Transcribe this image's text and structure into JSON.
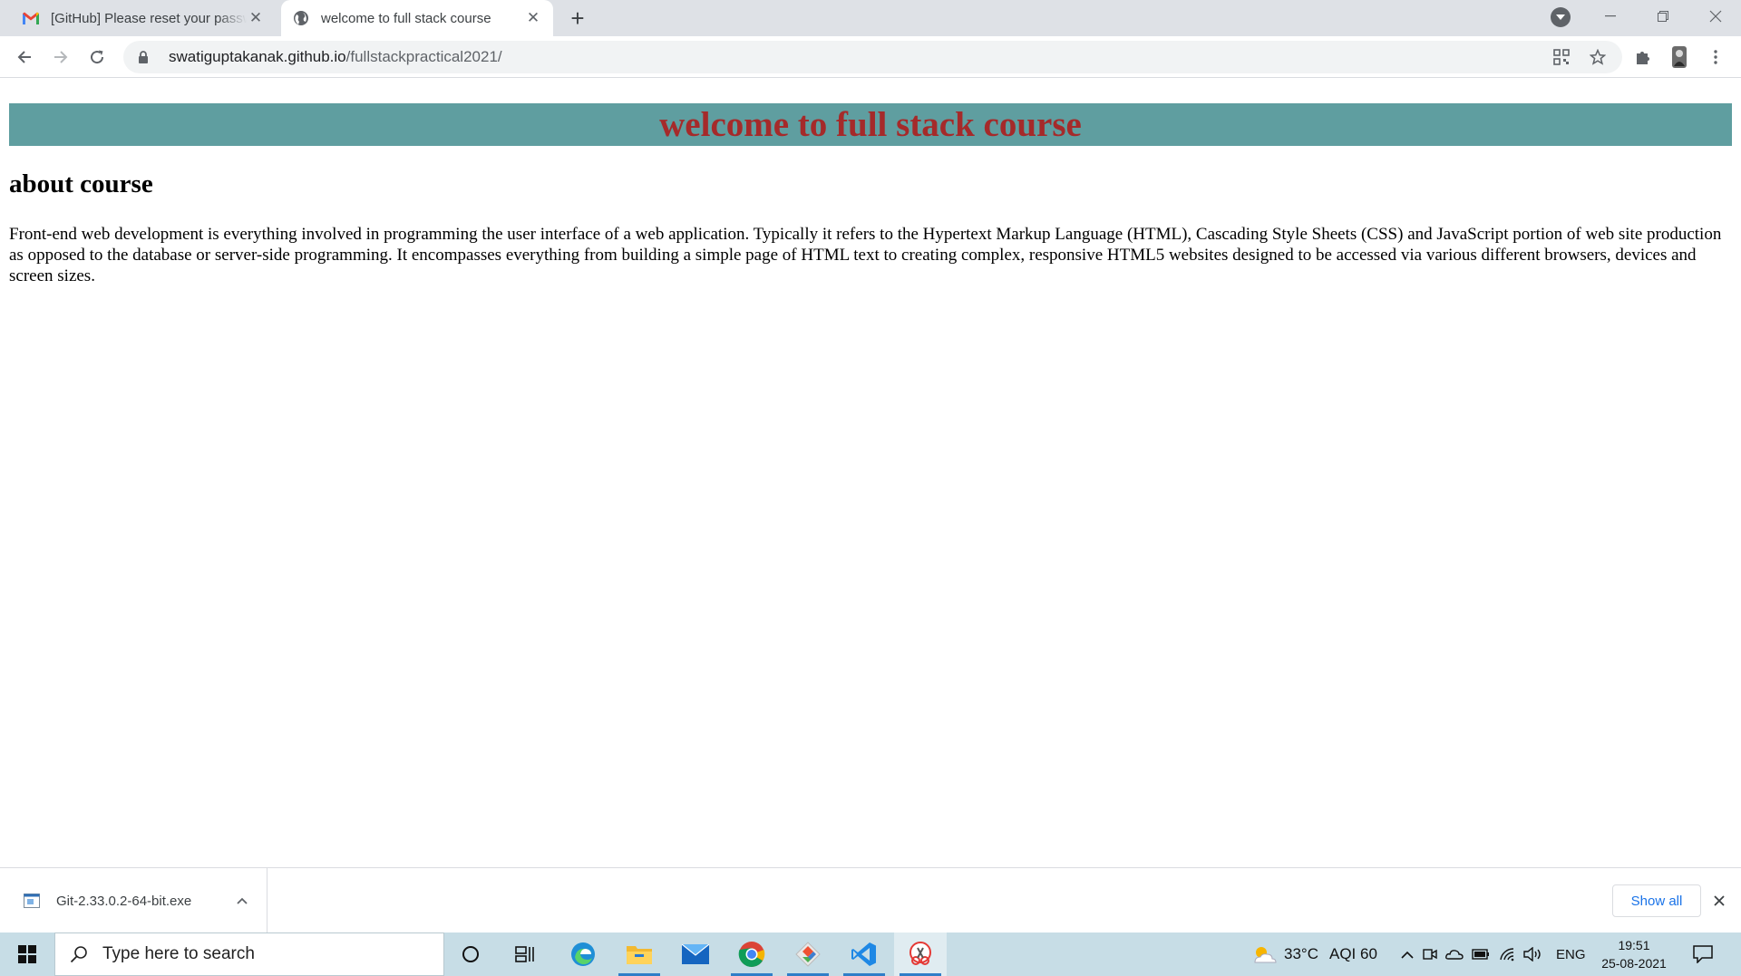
{
  "browser": {
    "tabs": [
      {
        "title": "[GitHub] Please reset your password",
        "favicon": "gmail-icon"
      },
      {
        "title": "welcome to full stack course",
        "favicon": "globe-icon"
      }
    ],
    "new_tab": "+",
    "url_host": "swatiguptakanak.github.io",
    "url_path": "/fullstackpractical2021/"
  },
  "page": {
    "banner_title": "welcome to full stack course",
    "section_heading": "about course",
    "paragraph": "Front-end web development is everything involved in programming the user interface of a web application. Typically it refers to the Hypertext Markup Language (HTML), Cascading Style Sheets (CSS) and JavaScript portion of web site production as opposed to the database or server-side programming. It encompasses everything from building a simple page of HTML text to creating complex, responsive HTML5 websites designed to be accessed via various different browsers, devices and screen sizes.",
    "colors": {
      "banner_bg": "#5f9ea0",
      "banner_text": "#a52a2a"
    }
  },
  "downloads": {
    "file_name": "Git-2.33.0.2-64-bit.exe",
    "show_all": "Show all"
  },
  "taskbar": {
    "search_placeholder": "Type here to search",
    "weather": "33°C",
    "aqi": "AQI 60",
    "language": "ENG",
    "time": "19:51",
    "date": "25-08-2021"
  }
}
